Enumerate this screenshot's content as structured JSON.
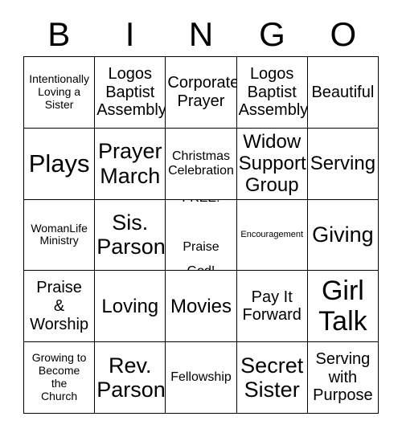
{
  "header": {
    "letters": [
      "B",
      "I",
      "N",
      "G",
      "O"
    ]
  },
  "grid": {
    "columns": 5,
    "rows": 5,
    "free_space_index": 12,
    "cells": [
      {
        "text": "Intentionally\nLoving a\nSister",
        "size": "fs-sm"
      },
      {
        "text": "Logos\nBaptist\nAssembly",
        "size": "fs-lg"
      },
      {
        "text": "Corporate\nPrayer",
        "size": "fs-lg"
      },
      {
        "text": "Logos\nBaptist\nAssembly",
        "size": "fs-lg"
      },
      {
        "text": "Beautiful",
        "size": "fs-lg"
      },
      {
        "text": "Plays",
        "size": "fs-3xl"
      },
      {
        "text": "Prayer\nMarch",
        "size": "fs-2xl"
      },
      {
        "text": "Christmas\nCelebration",
        "size": "fs-md"
      },
      {
        "text": "Widow\nSupport\nGroup",
        "size": "fs-xl"
      },
      {
        "text": "Serving",
        "size": "fs-xl"
      },
      {
        "text": "WomanLife\nMinistry",
        "size": "fs-sm"
      },
      {
        "text": "Sis.\nParson",
        "size": "fs-2xl"
      },
      {
        "text": "FREE!\n\nPraise\nGod!",
        "size": "fs-md"
      },
      {
        "text": "Encouragement",
        "size": "fs-xs"
      },
      {
        "text": "Giving",
        "size": "fs-2xl"
      },
      {
        "text": "Praise\n&\nWorship",
        "size": "fs-lg"
      },
      {
        "text": "Loving",
        "size": "fs-xl"
      },
      {
        "text": "Movies",
        "size": "fs-xl"
      },
      {
        "text": "Pay It\nForward",
        "size": "fs-lg"
      },
      {
        "text": "Girl\nTalk",
        "size": "fs-4xl"
      },
      {
        "text": "Growing to\nBecome\nthe\nChurch",
        "size": "fs-sm"
      },
      {
        "text": "Rev.\nParson",
        "size": "fs-2xl"
      },
      {
        "text": "Fellowship",
        "size": "fs-md"
      },
      {
        "text": "Secret\nSister",
        "size": "fs-2xl"
      },
      {
        "text": "Serving\nwith\nPurpose",
        "size": "fs-lg"
      }
    ]
  },
  "colors": {
    "background": "#ffffff",
    "text": "#000000",
    "border": "#000000"
  }
}
